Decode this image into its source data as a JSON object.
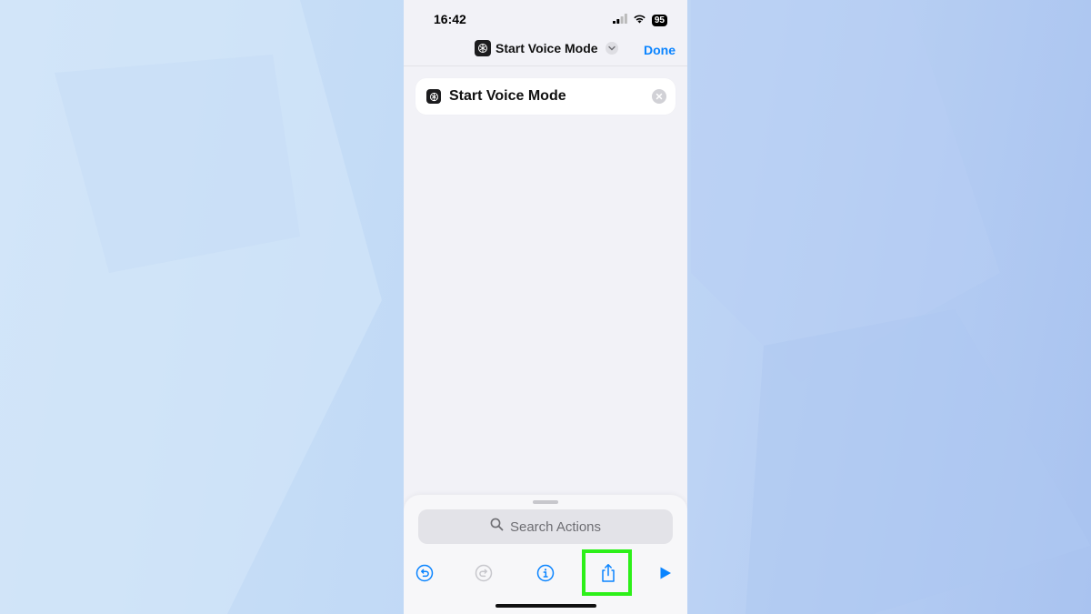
{
  "status_bar": {
    "time": "16:42",
    "battery": "95",
    "icons": [
      "cellular-signal-icon",
      "wifi-icon",
      "battery-icon"
    ]
  },
  "nav": {
    "title": "Start Voice Mode",
    "done_label": "Done",
    "app_icon": "chatgpt-app-icon"
  },
  "action": {
    "label": "Start Voice Mode",
    "app_icon": "chatgpt-app-icon"
  },
  "search": {
    "placeholder": "Search Actions"
  },
  "toolbar": {
    "items": [
      "undo-icon",
      "redo-icon",
      "info-icon",
      "share-icon",
      "play-icon"
    ]
  },
  "colors": {
    "accent": "#0a84ff",
    "highlight": "#2df019",
    "sheet_bg": "#f2f2f7"
  }
}
